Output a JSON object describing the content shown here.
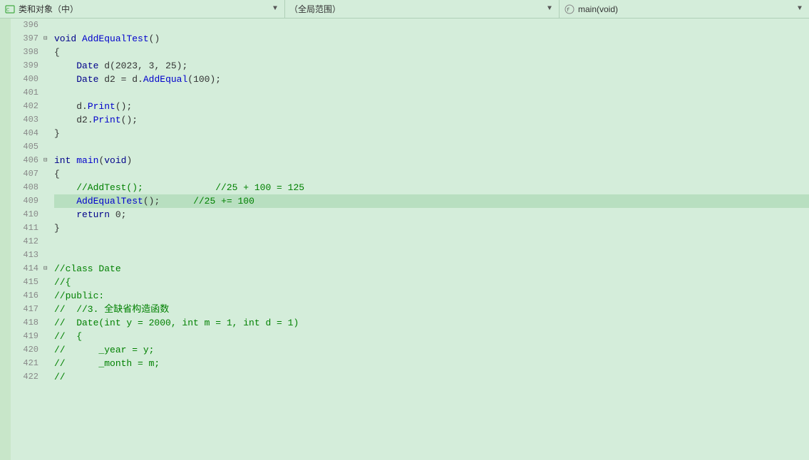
{
  "topbar": {
    "left_icon": "class-icon",
    "left_label": "类和对象（中）",
    "middle_label": "（全局范围）",
    "right_label": "main(void)",
    "right_icon": "function-icon"
  },
  "lines": [
    {
      "num": 396,
      "content": "",
      "highlight": false,
      "fold": false
    },
    {
      "num": 397,
      "content": "void AddEqualTest()",
      "highlight": false,
      "fold": true
    },
    {
      "num": 398,
      "content": "{",
      "highlight": false,
      "fold": false
    },
    {
      "num": 399,
      "content": "    Date d(2023, 3, 25);",
      "highlight": false,
      "fold": false
    },
    {
      "num": 400,
      "content": "    Date d2 = d.AddEqual(100);",
      "highlight": false,
      "fold": false
    },
    {
      "num": 401,
      "content": "",
      "highlight": false,
      "fold": false
    },
    {
      "num": 402,
      "content": "    d.Print();",
      "highlight": false,
      "fold": false
    },
    {
      "num": 403,
      "content": "    d2.Print();",
      "highlight": false,
      "fold": false
    },
    {
      "num": 404,
      "content": "}",
      "highlight": false,
      "fold": false
    },
    {
      "num": 405,
      "content": "",
      "highlight": false,
      "fold": false
    },
    {
      "num": 406,
      "content": "int main(void)",
      "highlight": false,
      "fold": true
    },
    {
      "num": 407,
      "content": "{",
      "highlight": false,
      "fold": false
    },
    {
      "num": 408,
      "content": "    //AddTest();             //25 + 100 = 125",
      "highlight": false,
      "fold": false
    },
    {
      "num": 409,
      "content": "    AddEqualTest();      //25 += 100",
      "highlight": true,
      "fold": false
    },
    {
      "num": 410,
      "content": "    return 0;",
      "highlight": false,
      "fold": false
    },
    {
      "num": 411,
      "content": "}",
      "highlight": false,
      "fold": false
    },
    {
      "num": 412,
      "content": "",
      "highlight": false,
      "fold": false
    },
    {
      "num": 413,
      "content": "",
      "highlight": false,
      "fold": false
    },
    {
      "num": 414,
      "content": "//class Date",
      "highlight": false,
      "fold": true
    },
    {
      "num": 415,
      "content": "//{",
      "highlight": false,
      "fold": false
    },
    {
      "num": 416,
      "content": "//public:",
      "highlight": false,
      "fold": false
    },
    {
      "num": 417,
      "content": "//  //3. 全缺省构造函数",
      "highlight": false,
      "fold": false
    },
    {
      "num": 418,
      "content": "//  Date(int y = 2000, int m = 1, int d = 1)",
      "highlight": false,
      "fold": false
    },
    {
      "num": 419,
      "content": "//  {",
      "highlight": false,
      "fold": false
    },
    {
      "num": 420,
      "content": "//      _year = y;",
      "highlight": false,
      "fold": false
    },
    {
      "num": 421,
      "content": "//      _month = m;",
      "highlight": false,
      "fold": false
    },
    {
      "num": 422,
      "content": "//",
      "highlight": false,
      "fold": false
    }
  ]
}
